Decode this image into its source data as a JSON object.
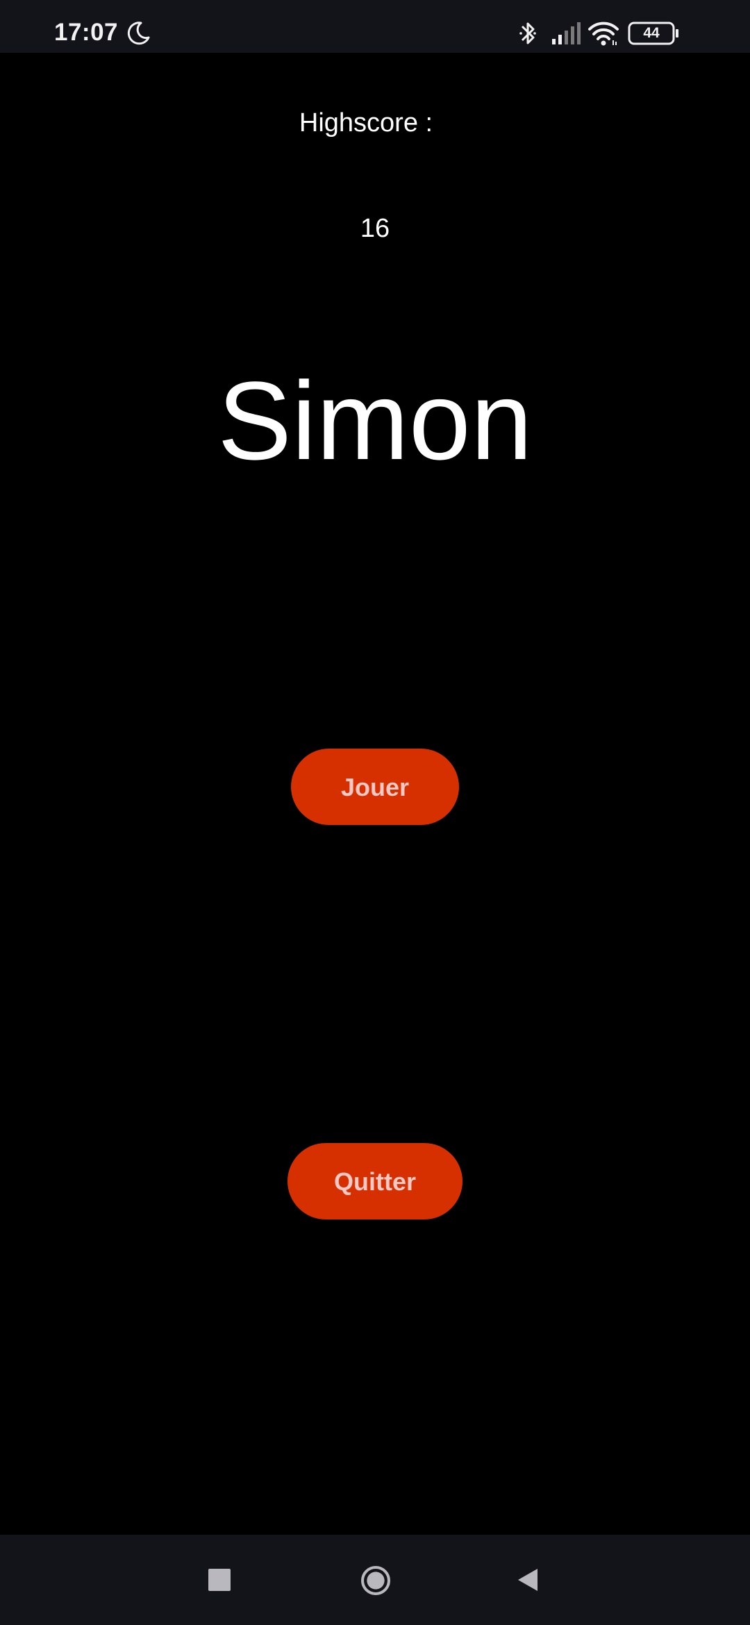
{
  "status_bar": {
    "time": "17:07",
    "battery_level": "44",
    "icons": [
      "moon-icon",
      "bluetooth-icon",
      "signal-icon",
      "wifi-icon",
      "battery-icon"
    ]
  },
  "main": {
    "highscore_label": "Highscore :",
    "highscore_value": "16",
    "title": "Simon",
    "play_label": "Jouer",
    "quit_label": "Quitter"
  },
  "nav_bar": {
    "icons": [
      "recents-icon",
      "home-icon",
      "back-icon"
    ]
  },
  "colors": {
    "background": "#000000",
    "bars": "#13131a",
    "button": "#d63000",
    "button_text": "#f7c8c4",
    "text": "#ffffff"
  }
}
